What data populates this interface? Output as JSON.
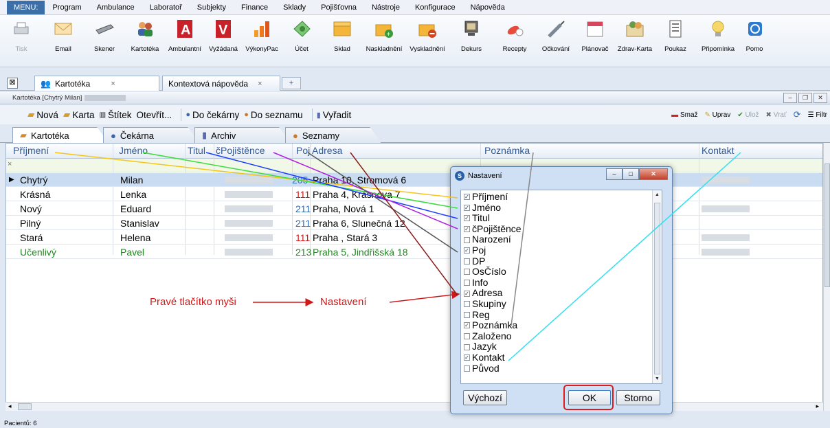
{
  "menu": {
    "menu_button": "MENU:",
    "items": [
      "Program",
      "Ambulance",
      "Laboratoř",
      "Subjekty",
      "Finance",
      "Sklady",
      "Pojišťovna",
      "Nástroje",
      "Konfigurace",
      "Nápověda"
    ]
  },
  "toolbar": {
    "items": [
      {
        "label": "Tisk",
        "icon": "printer-icon",
        "disabled": true
      },
      {
        "label": "Email",
        "icon": "envelope-icon"
      },
      {
        "label": "Skener",
        "icon": "scanner-icon"
      },
      {
        "label": "Kartotéka",
        "icon": "people-icon"
      },
      {
        "label": "Ambulantní",
        "icon": "letter-a-icon"
      },
      {
        "label": "Vyžádaná",
        "icon": "letter-v-icon"
      },
      {
        "label": "VýkonyPac",
        "icon": "bar-chart-icon"
      },
      {
        "label": "Účet",
        "icon": "money-icon"
      },
      {
        "label": "Sklad",
        "icon": "box-icon"
      },
      {
        "label": "Naskladnění",
        "icon": "box-add-icon"
      },
      {
        "label": "Vyskladnění",
        "icon": "box-remove-icon"
      },
      {
        "label": "Dekurs",
        "icon": "monitor-icon"
      },
      {
        "label": "Recepty",
        "icon": "pills-icon"
      },
      {
        "label": "Očkování",
        "icon": "syringe-icon"
      },
      {
        "label": "Plánovač",
        "icon": "calendar-icon"
      },
      {
        "label": "Zdrav-Karta",
        "icon": "health-card-icon"
      },
      {
        "label": "Poukaz",
        "icon": "document-icon"
      },
      {
        "label": "Připomínka",
        "icon": "lightbulb-icon"
      },
      {
        "label": "Pomo",
        "icon": "help-icon"
      }
    ]
  },
  "doc_tabs": {
    "tab1": "Kartotéka",
    "tab1_close": "×",
    "tab2": "Kontextová nápověda",
    "tab2_close": "×",
    "add": "+",
    "close_all": "⊠"
  },
  "window": {
    "title": "Kartotéka [Chytrý Milan]"
  },
  "actions": {
    "nova": "Nová",
    "karta": "Karta",
    "stitek": "Štítek",
    "otevrit": "Otevřít...",
    "do_cekarny": "Do čekárny",
    "do_seznamu": "Do seznamu",
    "vyradit": "Vyřadit",
    "smaz": "Smaž",
    "uprav": "Uprav",
    "uloz": "Ulož",
    "vrat": "Vrať",
    "filtr": "Filtr"
  },
  "sub_tabs": [
    "Kartotéka",
    "Čekárna",
    "Archiv",
    "Seznamy"
  ],
  "grid": {
    "columns": [
      "Příjmení",
      "Jméno",
      "Titul",
      "čPojištěnce",
      "Poj",
      "Adresa",
      "Poznámka",
      "Kontakt"
    ],
    "filter_clear": "×",
    "rows": [
      {
        "prijmeni": "Chytrý",
        "jmeno": "Milan",
        "poj": "205",
        "adresa": "Praha 10, Stromová 6"
      },
      {
        "prijmeni": "Krásná",
        "jmeno": "Lenka",
        "poj": "111",
        "adresa": "Praha 4, Krásnova 7"
      },
      {
        "prijmeni": "Nový",
        "jmeno": "Eduard",
        "poj": "211",
        "adresa": "Praha, Nová 1"
      },
      {
        "prijmeni": "Pilný",
        "jmeno": "Stanislav",
        "poj": "211",
        "adresa": "Praha 6, Slunečná 12"
      },
      {
        "prijmeni": "Stará",
        "jmeno": "Helena",
        "poj": "111",
        "adresa": "Praha , Stará 3"
      },
      {
        "prijmeni": "Učenlivý",
        "jmeno": "Pavel",
        "poj": "213",
        "adresa": "Praha 5, Jindřišská 18"
      }
    ]
  },
  "annotation": {
    "left": "Pravé tlačítko myši",
    "right": "Nastavení"
  },
  "dialog": {
    "title": "Nastavení",
    "items": [
      {
        "label": "Příjmení",
        "checked": true
      },
      {
        "label": "Jméno",
        "checked": true
      },
      {
        "label": "Titul",
        "checked": true
      },
      {
        "label": "čPojištěnce",
        "checked": true
      },
      {
        "label": "Narození",
        "checked": false
      },
      {
        "label": "Poj",
        "checked": true
      },
      {
        "label": "DP",
        "checked": false
      },
      {
        "label": "OsČíslo",
        "checked": false
      },
      {
        "label": "Info",
        "checked": false
      },
      {
        "label": "Adresa",
        "checked": true
      },
      {
        "label": "Skupiny",
        "checked": false
      },
      {
        "label": "Reg",
        "checked": false
      },
      {
        "label": "Poznámka",
        "checked": true
      },
      {
        "label": "Založeno",
        "checked": false
      },
      {
        "label": "Jazyk",
        "checked": false
      },
      {
        "label": "Kontakt",
        "checked": true
      },
      {
        "label": "Původ",
        "checked": false
      }
    ],
    "default_button": "Výchozí",
    "ok_button": "OK",
    "cancel_button": "Storno"
  },
  "status": {
    "text": "Pacientů: 6"
  },
  "colors": {
    "accent": "#3c6fa8",
    "highlight_red": "#e01a1a",
    "selected_row": "#c9dcf2",
    "arrow_prijmeni": "#f5c518",
    "arrow_jmeno": "#3cdc3c",
    "arrow_titul": "#1a3cff",
    "arrow_cpojistence": "#b020e0",
    "arrow_poj": "#555555",
    "arrow_adresa": "#8b1a1a",
    "arrow_poznamka": "#888888",
    "arrow_kontakt": "#30e0f0"
  }
}
